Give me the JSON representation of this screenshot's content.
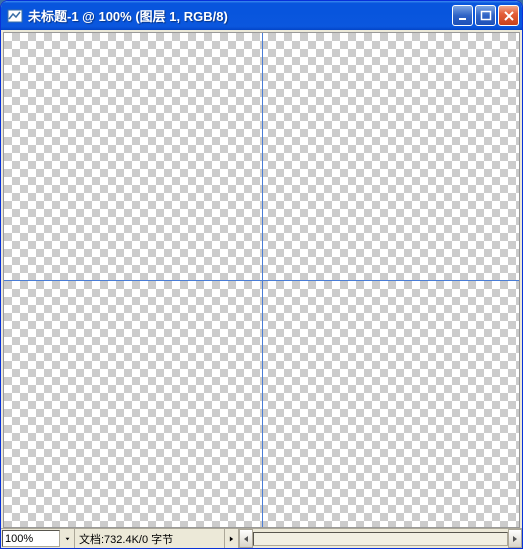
{
  "titlebar": {
    "title": "未标题-1 @ 100% (图层 1, RGB/8)"
  },
  "statusbar": {
    "zoom": "100%",
    "doc_label": "文档:732.4K/0 字节"
  }
}
